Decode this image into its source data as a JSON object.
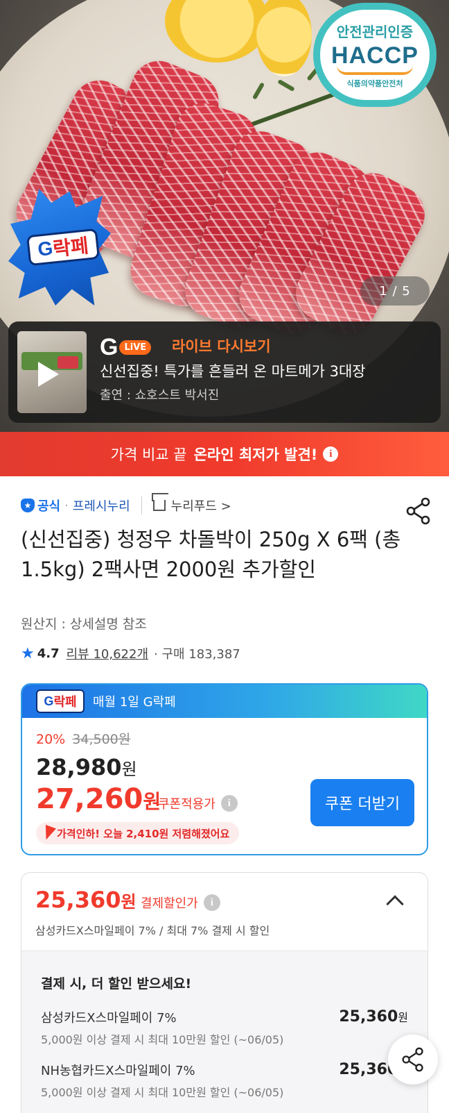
{
  "hero": {
    "haccp": {
      "line1": "안전관리인증",
      "line2": "HACCP",
      "line3": "식품의약품안전처"
    },
    "promo_badge": {
      "g": "G",
      "rest": "락페"
    },
    "page_counter": "1 / 5",
    "live": {
      "g_logo": "G",
      "live_tag": "LiVE",
      "title": "라이브 다시보기",
      "headline": "신선집중! 특가를 흔들러 온 마트메가 3대장",
      "cast": "출연 : 쇼호스트 박서진"
    }
  },
  "banner": {
    "prefix": "가격 비교 끝",
    "highlight": "온라인 최저가 발견!",
    "info": "i"
  },
  "store": {
    "official_icon": "★",
    "official_label": "공식",
    "dot": "·",
    "store_name": "프레시누리",
    "brand_name": "누리푸드 >"
  },
  "product": {
    "title": "(신선집중) 청정우 차돌박이 250g X 6팩 (총 1.5kg) 2팩사면 2000원 추가할인",
    "origin": "원산지 : 상세설명 참조",
    "star": "★",
    "rating": "4.7",
    "reviews": "리뷰 10,622개",
    "purchases": "· 구매 183,387"
  },
  "g_card": {
    "badge_g": "G",
    "badge_rest": "락페",
    "header": "매월 1일 G락페",
    "discount_pct": "20%",
    "original_price": "34,500원",
    "sale_price": "28,980",
    "sale_unit": "원",
    "coupon_price": "27,260",
    "coupon_unit": "원",
    "coupon_label": "쿠폰적용가",
    "info": "i",
    "coupon_button": "쿠폰 더받기",
    "price_drop": "가격인하! 오늘 2,410원 저렴해졌어요"
  },
  "payment": {
    "price": "25,360",
    "unit": "원",
    "label": "결제할인가",
    "info": "i",
    "sub": "삼성카드X스마일페이 7% / 최대 7% 결제 시 할인",
    "more_title": "결제 시, 더 할인 받으세요!",
    "offers": [
      {
        "name": "삼성카드X스마일페이 7%",
        "cond": "5,000원 이상 결제 시 최대 10만원 할인 (~06/05)",
        "amount": "25,360",
        "unit": "원"
      },
      {
        "name": "NH농협카드X스마일페이 7%",
        "cond": "5,000원 이상 결제 시 최대 10만원 할인 (~06/05)",
        "amount": "25,360",
        "unit": "원"
      }
    ]
  },
  "colors": {
    "accent_red": "#f03a2c",
    "accent_blue": "#1a73e8",
    "haccp_teal": "#43c1c1"
  },
  "icons": [
    "share-icon",
    "star-icon",
    "home-icon",
    "info-icon",
    "chevron-up-icon",
    "play-icon"
  ]
}
